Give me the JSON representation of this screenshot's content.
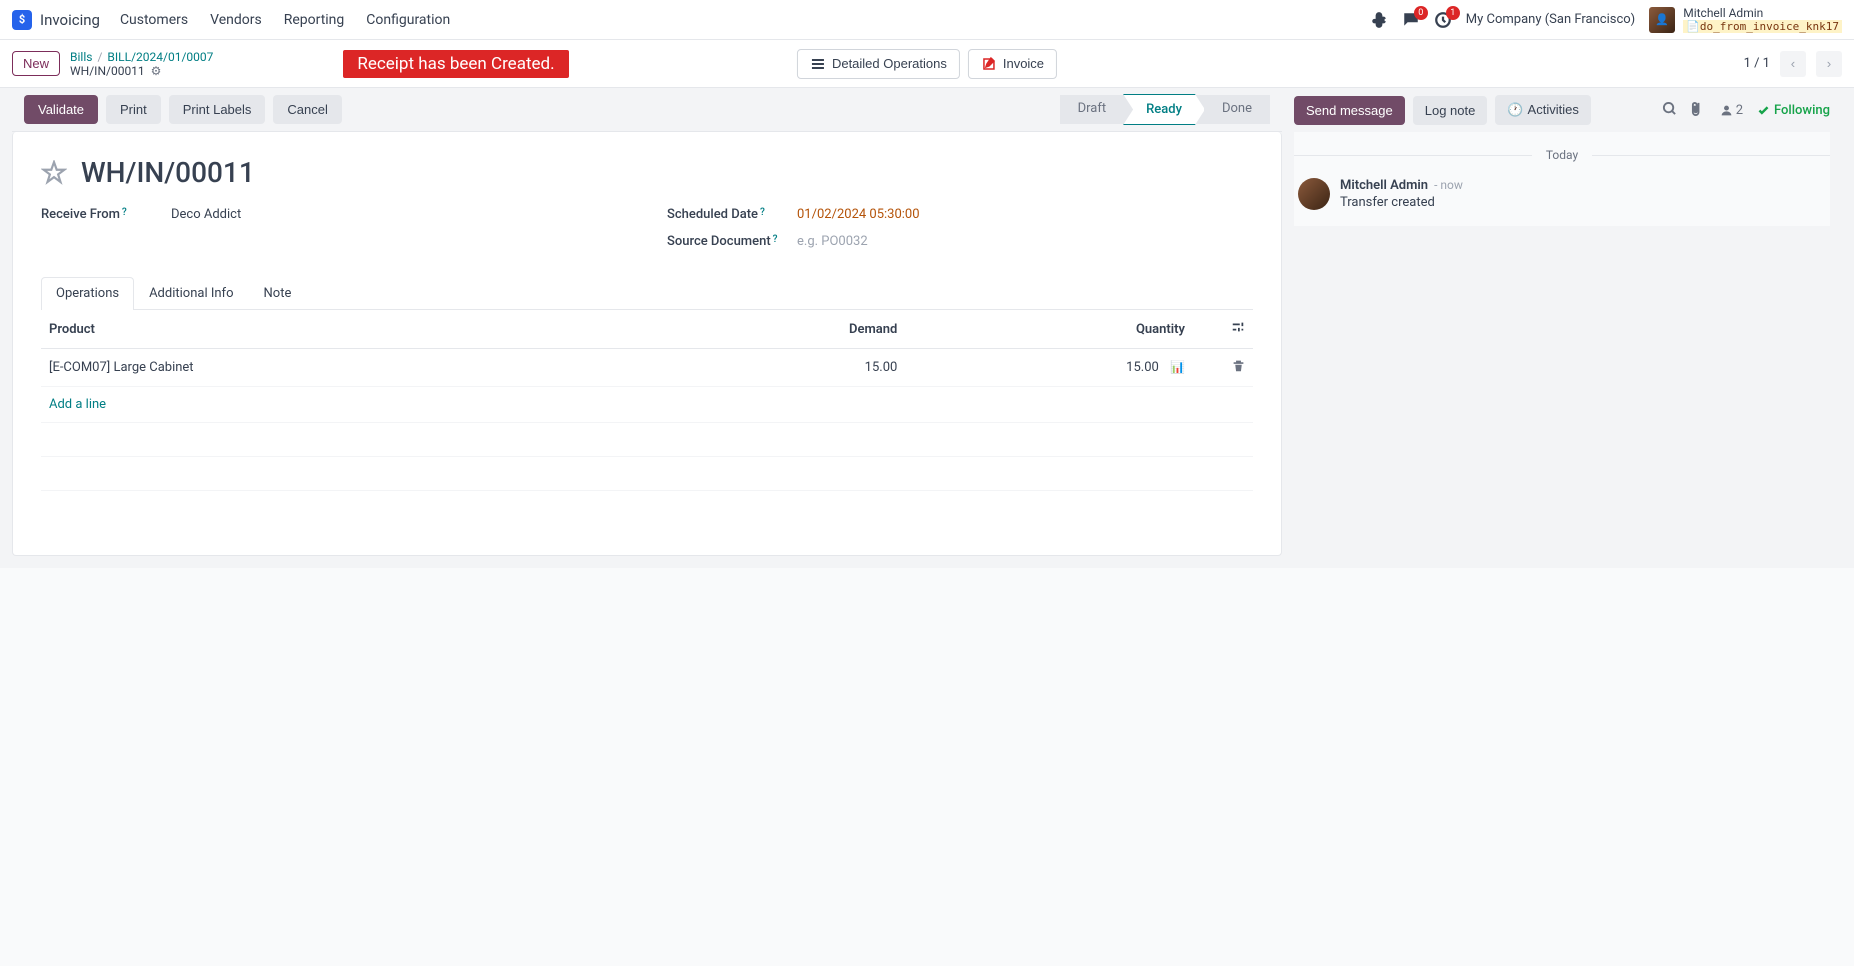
{
  "nav": {
    "app_name": "Invoicing",
    "menu": [
      "Customers",
      "Vendors",
      "Reporting",
      "Configuration"
    ],
    "chat_badge": "0",
    "activity_badge": "1",
    "company": "My Company (San Francisco)",
    "user_name": "Mitchell Admin",
    "user_db": "do_from_invoice_knk17"
  },
  "control_panel": {
    "new_btn": "New",
    "breadcrumb": {
      "bills": "Bills",
      "bill_ref": "BILL/2024/01/0007",
      "current": "WH/IN/00011"
    },
    "alert": "Receipt has been Created.",
    "detailed_ops": "Detailed Operations",
    "invoice": "Invoice",
    "pager": "1 / 1"
  },
  "status_bar": {
    "validate": "Validate",
    "print": "Print",
    "print_labels": "Print Labels",
    "cancel": "Cancel",
    "statuses": {
      "draft": "Draft",
      "ready": "Ready",
      "done": "Done"
    }
  },
  "form": {
    "title": "WH/IN/00011",
    "fields": {
      "receive_from_label": "Receive From",
      "receive_from_value": "Deco Addict",
      "scheduled_date_label": "Scheduled Date",
      "scheduled_date_value": "01/02/2024 05:30:00",
      "source_doc_label": "Source Document",
      "source_doc_placeholder": "e.g. PO0032"
    },
    "tabs": {
      "operations": "Operations",
      "additional_info": "Additional Info",
      "note": "Note"
    },
    "table": {
      "headers": {
        "product": "Product",
        "demand": "Demand",
        "quantity": "Quantity"
      },
      "row": {
        "product": "[E-COM07] Large Cabinet",
        "demand": "15.00",
        "quantity": "15.00"
      },
      "add_line": "Add a line"
    }
  },
  "chatter": {
    "send_message": "Send message",
    "log_note": "Log note",
    "activities": "Activities",
    "follower_count": "2",
    "following": "Following",
    "today": "Today",
    "message": {
      "author": "Mitchell Admin",
      "time": "- now",
      "body": "Transfer created"
    }
  }
}
